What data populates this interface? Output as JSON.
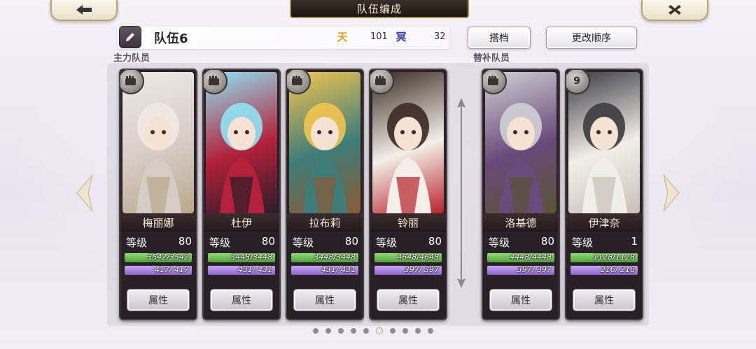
{
  "header": {
    "title": "队伍编成",
    "back_icon": "arrow-left-icon",
    "close_icon": "close-icon"
  },
  "team": {
    "name": "队伍6",
    "stat1_icon": "天",
    "stat1_value": "101",
    "stat2_icon": "冥",
    "stat2_value": "32",
    "partner_button": "搭档",
    "reorder_button": "更改顺序"
  },
  "sections": {
    "main": "主力队员",
    "sub": "替补队员"
  },
  "level_label": "等级",
  "attr_label": "属性",
  "main_members": [
    {
      "name": "梅丽娜",
      "level": "80",
      "hp": "3542/3542",
      "sp": "417/ 417",
      "badge": "",
      "colors": [
        "#efe9e4",
        "#d6ccc6",
        "#b9a98a"
      ]
    },
    {
      "name": "杜伊",
      "level": "80",
      "hp": "3448/3448",
      "sp": "431/ 431",
      "badge": "",
      "colors": [
        "#8fe3f4",
        "#b3213a",
        "#2c1d2a"
      ]
    },
    {
      "name": "拉布莉",
      "level": "80",
      "hp": "3448/3448",
      "sp": "431/ 431",
      "badge": "",
      "colors": [
        "#f2c44f",
        "#3e7d7a",
        "#8a5a34"
      ]
    },
    {
      "name": "铃丽",
      "level": "80",
      "hp": "4648/4648",
      "sp": "397/ 397",
      "badge": "",
      "colors": [
        "#3a2a25",
        "#f3efe8",
        "#b7222b"
      ]
    }
  ],
  "sub_members": [
    {
      "name": "洛基德",
      "level": "80",
      "hp": "4448/4448",
      "sp": "397/ 397",
      "badge": "",
      "colors": [
        "#cfd0d4",
        "#6a4a7a",
        "#5a5334"
      ]
    },
    {
      "name": "伊津奈",
      "level": "1",
      "hp": "1128/1128",
      "sp": "216/ 216",
      "badge": "9",
      "colors": [
        "#3b3b40",
        "#f1eeea",
        "#c9c0b8"
      ]
    }
  ],
  "pagination": {
    "count": 10,
    "active": 5
  }
}
